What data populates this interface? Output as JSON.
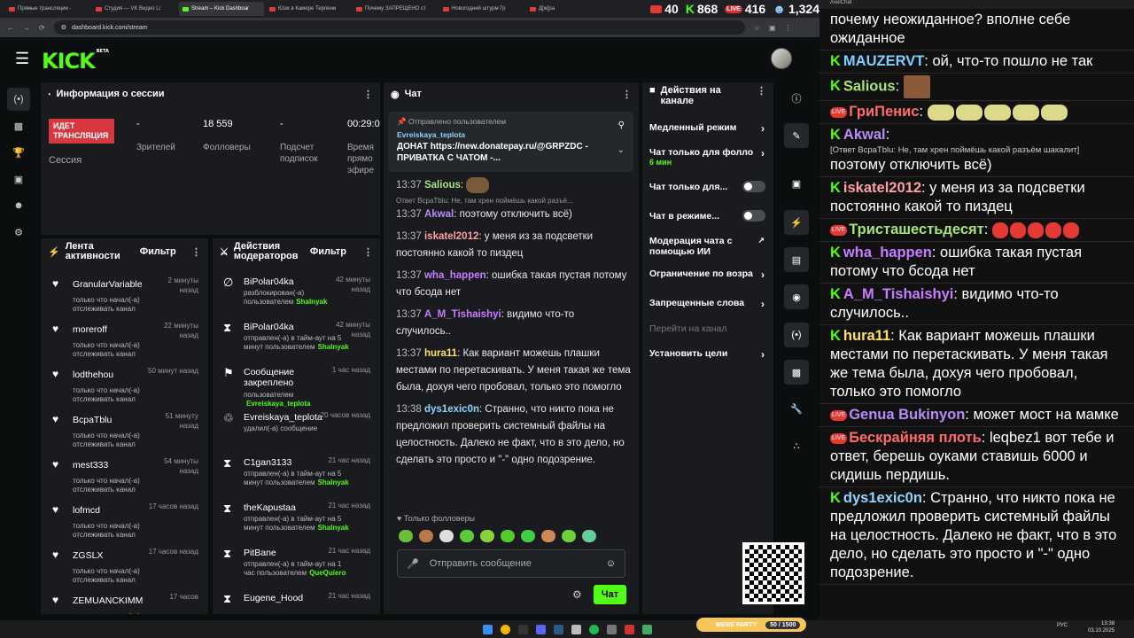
{
  "browser": {
    "tabs": [
      "Прямые трансляции -",
      "Студия — VK Видео Li",
      "Stream – Kick Dashboar",
      "Юзж в Камере Терпени",
      "Почему ЗАПРЕЩЕНО ст",
      "Новогодний штурм Гр",
      "Д[ж]ра"
    ],
    "url": "dashboard.kick.com/stream"
  },
  "stats": {
    "youtube": "40",
    "kick": "868",
    "vk": "416",
    "total": "1,324"
  },
  "header": {
    "logo": "KICK",
    "logo_sup": "BETA"
  },
  "session": {
    "title": "Информация о сессии",
    "live_badge": "ИДЕТ ТРАНСЛЯЦИЯ",
    "session_label": "Сессия",
    "viewers_val": "-",
    "viewers_label": "Зрителей",
    "followers_val": "18 559",
    "followers_label": "Фолловеры",
    "subs_val": "-",
    "subs_label": "Подсчет подписок",
    "time_val": "00:29:0",
    "time_label": "Время прямо эфире"
  },
  "activity": {
    "title": "Лента активности",
    "filter": "Фильтр",
    "desc": "только что начал(-а) отслеживать канал",
    "items": [
      {
        "name": "GranularVariable",
        "time": "2 минуты назад"
      },
      {
        "name": "moreroff",
        "time": "22 минуты назад"
      },
      {
        "name": "lodthehou",
        "time": "50 минут назад"
      },
      {
        "name": "BcpaTblu",
        "time": "51 минуту назад"
      },
      {
        "name": "mest333",
        "time": "54 минуты назад"
      },
      {
        "name": "lofmcd",
        "time": "17 часов назад"
      },
      {
        "name": "ZGSLX",
        "time": "17 часов назад"
      },
      {
        "name": "ZEMUANCKIMM",
        "time": "17 часов"
      }
    ]
  },
  "mod": {
    "title": "Действия модераторов",
    "filter": "Фильтр",
    "items": [
      {
        "name": "BiPolar04ka",
        "time": "42 минуты назад",
        "d1": "разблокирован(-а)",
        "d2": "пользователем",
        "by": "Shalnyak"
      },
      {
        "name": "BiPolar04ka",
        "time": "42 минуты назад",
        "d1": "отправлен(-а) в тайм-аут на 5",
        "d2": "минут пользователем",
        "by": "Shalnyak"
      },
      {
        "name": "Сообщение закреплено",
        "time": "1 час назад",
        "d1": "пользователем",
        "d2": "",
        "by": "Evreiskaya_teplota"
      },
      {
        "name": "Evreiskaya_teplota",
        "time": "20 часов назад",
        "d1": "удалил(-а) сообщение",
        "d2": "",
        "by": ""
      },
      {
        "name": "C1gan3133",
        "time": "21 час назад",
        "d1": "отправлен(-а) в тайм-аут на 5",
        "d2": "минут пользователем",
        "by": "Shalnyak"
      },
      {
        "name": "theKapustaa",
        "time": "21 час назад",
        "d1": "отправлен(-а) в тайм-аут на 5",
        "d2": "минут пользователем",
        "by": "Shalnyak"
      },
      {
        "name": "PitBane",
        "time": "21 час назад",
        "d1": "отправлен(-а) в тайм-аут на 1",
        "d2": "час пользователем",
        "by": "QueQuiero"
      },
      {
        "name": "Eugene_Hood",
        "time": "21 час назад",
        "d1": "",
        "d2": "",
        "by": ""
      }
    ]
  },
  "chat": {
    "title": "Чат",
    "pinned_label": "Отправлено пользователем",
    "pinned_user": "Evreiskaya_teplota",
    "pinned_text": "ДОНАТ https://new.donatepay.ru/@GRPZDC - ПРИВАТКА С ЧАТОМ -...",
    "reply_text": "Ответ BcpaTblu: Не, там хрен поймёшь какой разъё...",
    "messages": [
      {
        "time": "13:37",
        "user": "Salious",
        "text": "",
        "color": "#a6e37a"
      },
      {
        "time": "13:37",
        "user": "Akwal",
        "text": "поэтому отключить всё)",
        "color": "#b88cf7"
      },
      {
        "time": "13:37",
        "user": "iskatel2012",
        "text": "у меня из за подсветки постоянно какой то пиздец",
        "color": "#ff9ea5"
      },
      {
        "time": "13:37",
        "user": "wha_happen",
        "text": "ошибка такая пустая потому что бсода нет",
        "color": "#c77dff"
      },
      {
        "time": "13:37",
        "user": "A_M_Tishaishyi",
        "text": "видимо что-то случилось..",
        "color": "#c77dff"
      },
      {
        "time": "13:37",
        "user": "hura11",
        "text": "Как вариант можешь плашки местами по перетаскивать. У меня такая же тема была, дохуя чего пробовал, только это помогло",
        "color": "#ffe066"
      },
      {
        "time": "13:38",
        "user": "dys1exic0n",
        "text": "Странно, что никто пока не предложил проверить системный файлы на целостность. Далеко не факт, что в это дело, но сделать это просто и \"-\" одно подозрение.",
        "color": "#8fd3ff"
      }
    ],
    "followers_only": "Только фолловеры",
    "input_placeholder": "Отправить сообщение",
    "send": "Чат"
  },
  "actions": {
    "title": "Действия на канале",
    "items": [
      "Медленный режим",
      "Чат только для фолло",
      "Чат только для...",
      "Чат в режиме...",
      "Модерация чата с помощью ИИ",
      "Ограничение по возра",
      "Запрещенные слова",
      "Перейти на канал",
      "Установить цели"
    ],
    "slow_sub": "6 мин"
  },
  "overlay": {
    "title": "AxelChat",
    "messages": [
      {
        "user": "",
        "color": "#fff",
        "text": "почему неожиданное? вполне себе ожиданное",
        "src": ""
      },
      {
        "user": "MAUZERVT",
        "color": "#7fd0ff",
        "text": "ой, что-то пошло не так",
        "src": "kick"
      },
      {
        "user": "Salious",
        "color": "#a6e37a",
        "text": "",
        "src": "kick"
      },
      {
        "user": "ГриПенис",
        "color": "#ff6b6b",
        "text": "",
        "src": "vk"
      },
      {
        "user": "Akwal",
        "color": "#b88cf7",
        "text": "поэтому отключить всё)",
        "src": "kick",
        "reply": "[Ответ BcpaTblu: Не, там хрен поймёшь какой разъём шакалит]"
      },
      {
        "user": "iskatel2012",
        "color": "#ff9ea5",
        "text": "у меня из за подсветки постоянно какой то пиздец",
        "src": "kick"
      },
      {
        "user": "Тристашестьдесят",
        "color": "#a6e37a",
        "text": "",
        "src": "vk"
      },
      {
        "user": "wha_happen",
        "color": "#c77dff",
        "text": "ошибка такая пустая потому что бсода нет",
        "src": "kick"
      },
      {
        "user": "A_M_Tishaishyi",
        "color": "#c77dff",
        "text": "видимо что-то случилось..",
        "src": "kick"
      },
      {
        "user": "hura11",
        "color": "#ffe066",
        "text": "Как вариант можешь плашки местами по перетаскивать. У меня такая же тема была, дохуя чего пробовал, только это помогло",
        "src": "kick"
      },
      {
        "user": "Genua Bukinyon",
        "color": "#b88cf7",
        "text": "может мост на мамке",
        "src": "vk"
      },
      {
        "user": "Бескрайняя плоть",
        "color": "#ff6b6b",
        "text": "leqbez1 вот тебе и ответ, берешь оуками ставишь 6000 и сидишь пердишь.",
        "src": "vk"
      },
      {
        "user": "dys1exic0n",
        "color": "#8fd3ff",
        "text": "Странно, что никто пока не предложил проверить системный файлы на целостность. Далеко не факт, что в это дело, но сделать это просто и \"-\" одно подозрение.",
        "src": "kick"
      }
    ]
  },
  "taskbar": {
    "lang": "РУС",
    "time": "13:38",
    "date": "03.10.2025",
    "meme": "MEME PARTY",
    "meme_count": "50 / 1500"
  }
}
